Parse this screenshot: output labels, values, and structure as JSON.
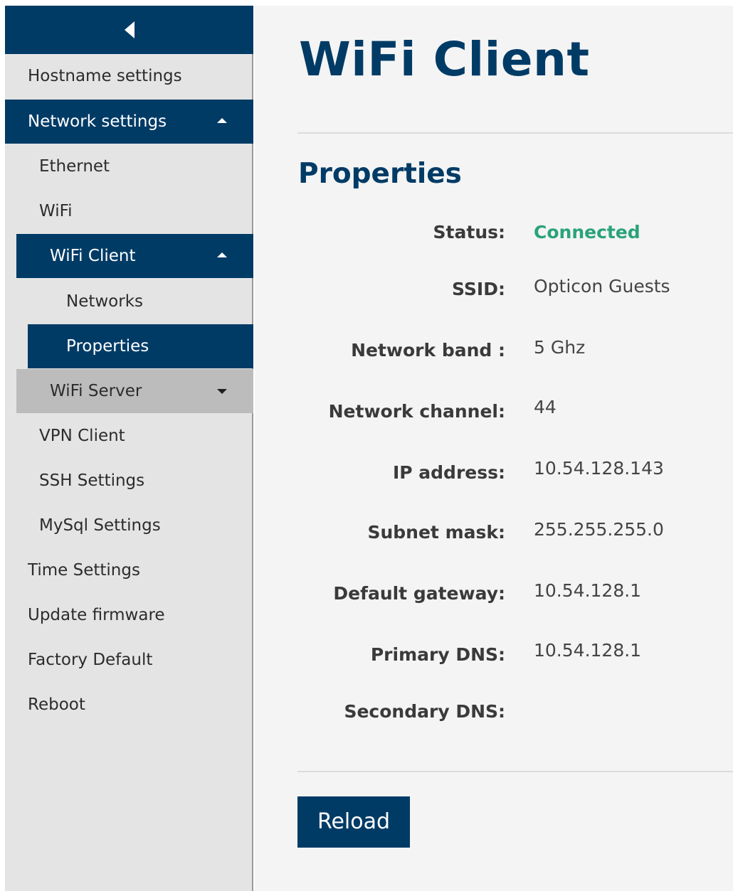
{
  "sidebar": {
    "items": [
      {
        "label": "Hostname settings"
      },
      {
        "label": "Network settings"
      },
      {
        "label": "Ethernet"
      },
      {
        "label": "WiFi"
      },
      {
        "label": "WiFi Client"
      },
      {
        "label": "Networks"
      },
      {
        "label": "Properties"
      },
      {
        "label": "WiFi Server"
      },
      {
        "label": "VPN Client"
      },
      {
        "label": "SSH Settings"
      },
      {
        "label": "MySql Settings"
      },
      {
        "label": "Time Settings"
      },
      {
        "label": "Update firmware"
      },
      {
        "label": "Factory Default"
      },
      {
        "label": "Reboot"
      }
    ]
  },
  "main": {
    "title": "WiFi Client",
    "section_title": "Properties",
    "properties": [
      {
        "label": "Status:",
        "value": "Connected"
      },
      {
        "label": "SSID:",
        "value": "Opticon Guests"
      },
      {
        "label": "Network band :",
        "value": "5 Ghz"
      },
      {
        "label": "Network channel:",
        "value": "44"
      },
      {
        "label": "IP address:",
        "value": "10.54.128.143"
      },
      {
        "label": "Subnet mask:",
        "value": "255.255.255.0"
      },
      {
        "label": "Default gateway:",
        "value": "10.54.128.1"
      },
      {
        "label": "Primary DNS:",
        "value": "10.54.128.1"
      },
      {
        "label": "Secondary DNS:",
        "value": ""
      }
    ],
    "reload_label": "Reload"
  },
  "colors": {
    "accent": "#003b66",
    "status_connected": "#2aa37a",
    "sidebar_bg": "#e4e4e4",
    "main_bg": "#f4f4f4"
  },
  "icons": {
    "collapse": "chevron-left-icon",
    "expanded": "caret-up-icon",
    "collapsed": "caret-down-icon"
  }
}
